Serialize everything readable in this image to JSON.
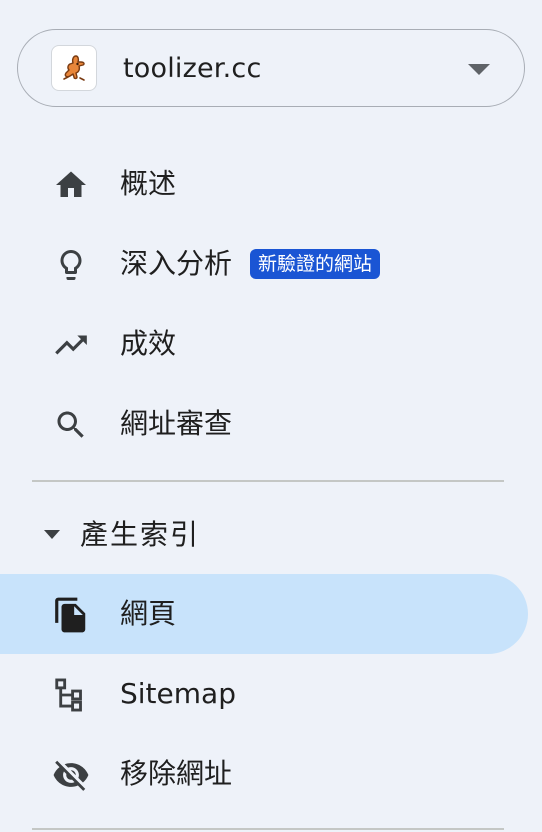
{
  "property": {
    "name": "toolizer.cc",
    "favicon": "rabbit-logo-icon",
    "dropdown_icon": "dropdown-arrow-icon"
  },
  "nav": {
    "overview": {
      "label": "概述",
      "icon": "home-icon"
    },
    "insights": {
      "label": "深入分析",
      "icon": "lightbulb-icon",
      "badge": "新驗證的網站"
    },
    "performance": {
      "label": "成效",
      "icon": "trending-up-icon"
    },
    "url_inspection": {
      "label": "網址審查",
      "icon": "search-icon"
    }
  },
  "indexing": {
    "section_label": "產生索引",
    "items": {
      "pages": {
        "label": "網頁",
        "icon": "pages-copy-icon",
        "active": true
      },
      "sitemap": {
        "label": "Sitemap",
        "icon": "sitemap-icon"
      },
      "removals": {
        "label": "移除網址",
        "icon": "eye-off-icon"
      }
    }
  },
  "colors": {
    "background": "#eef2f9",
    "active_background": "#c8e3fb",
    "badge_background": "#1a55d4",
    "text": "#1f1f1f",
    "icon": "#3c4043"
  }
}
